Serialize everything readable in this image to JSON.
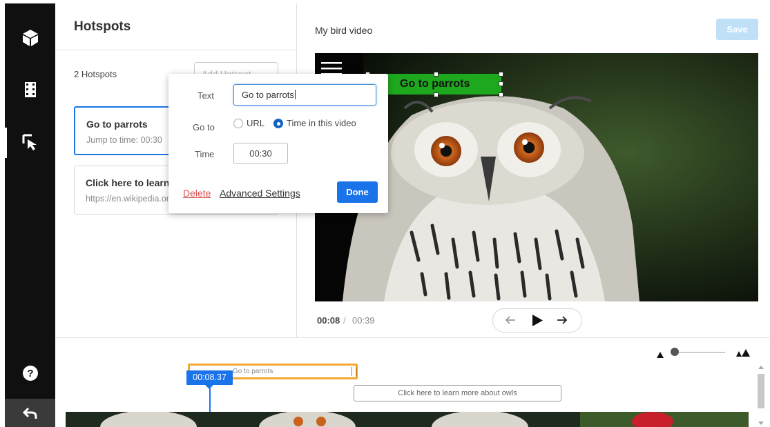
{
  "panel": {
    "title": "Hotspots",
    "hotspot_count": "2 Hotspots",
    "add_button_label": "Add Hotspot",
    "cards": [
      {
        "title": "Go to parrots",
        "subtitle": "Jump to time: 00:30",
        "selected": true
      },
      {
        "title": "Click here to learn more about owls",
        "subtitle": "https://en.wikipedia.org/wiki/Owl",
        "selected": false
      }
    ]
  },
  "editor": {
    "text_label": "Text",
    "text_value": "Go to parrots",
    "goto_label": "Go to",
    "option_url": "URL",
    "option_time": "Time in this video",
    "selected_option": "time",
    "time_label": "Time",
    "time_value": "00:30",
    "delete_label": "Delete",
    "advanced_label": "Advanced Settings",
    "done_label": "Done"
  },
  "video": {
    "title": "My bird video",
    "save_label": "Save",
    "hotspot_text": "Go to parrots",
    "current_time": "00:08",
    "separator": "/",
    "total_time": "00:39"
  },
  "timeline": {
    "playhead_time": "00:08.37",
    "segment1_label": "Go to parrots",
    "segment2_label": "Click here to learn more about owls"
  },
  "colors": {
    "accent": "#1a73e8",
    "rail": "#101010",
    "hotspot_bg": "#1ea81e",
    "segment_border": "#f3a82f",
    "delete": "#d9534f",
    "save_disabled": "#bfe0f7"
  },
  "icons": {
    "rail": [
      "cube-icon",
      "film-icon",
      "cursor-hotspot-icon",
      "help-icon",
      "back-arrow-icon"
    ],
    "controls": [
      "arrow-left-icon",
      "play-icon",
      "arrow-right-icon"
    ],
    "zoom": [
      "zoom-out-icon",
      "zoom-in-icon"
    ],
    "video_menu": "hamburger-icon"
  }
}
